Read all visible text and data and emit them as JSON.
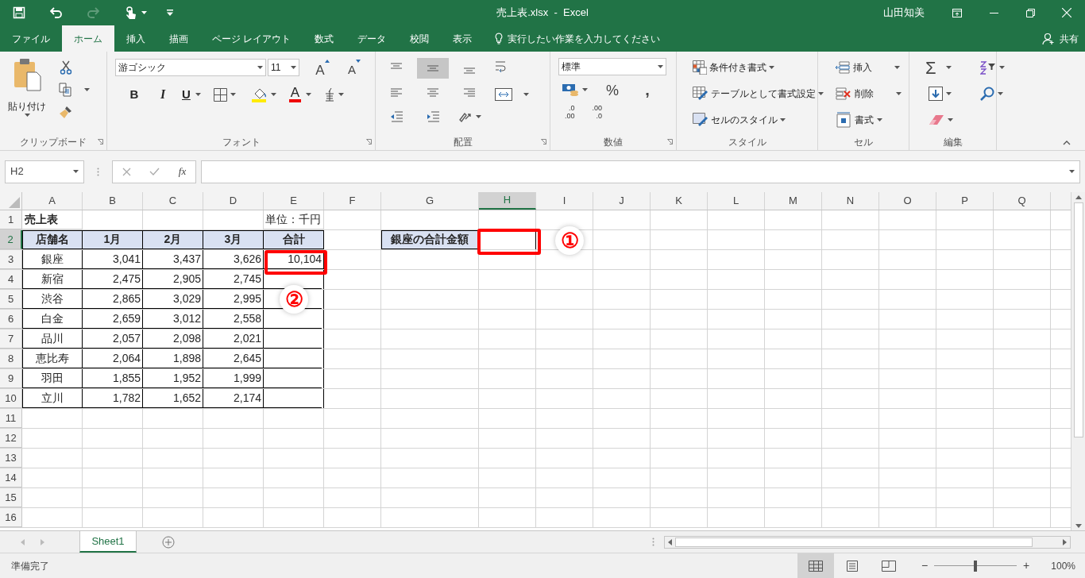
{
  "title_bar": {
    "title": "売上表.xlsx  -  Excel",
    "user": "山田知美"
  },
  "menu_tabs": [
    {
      "label": "ファイル",
      "selected": false
    },
    {
      "label": "ホーム",
      "selected": true
    },
    {
      "label": "挿入",
      "selected": false
    },
    {
      "label": "描画",
      "selected": false
    },
    {
      "label": "ページ レイアウト",
      "selected": false
    },
    {
      "label": "数式",
      "selected": false
    },
    {
      "label": "データ",
      "selected": false
    },
    {
      "label": "校閲",
      "selected": false
    },
    {
      "label": "表示",
      "selected": false
    }
  ],
  "tell_me": "実行したい作業を入力してください",
  "share": "共有",
  "ribbon": {
    "clipboard": {
      "paste": "貼り付け",
      "label": "クリップボード"
    },
    "font": {
      "font_name": "游ゴシック",
      "font_size": "11",
      "grow": "A",
      "shrink": "A",
      "bold": "B",
      "italic": "I",
      "underline": "U",
      "font_color": "A",
      "label": "フォント"
    },
    "alignment": {
      "vertical": [
        {
          "kind": "top",
          "selected": false
        },
        {
          "kind": "middle",
          "selected": true
        },
        {
          "kind": "bottom",
          "selected": false
        }
      ],
      "label": "配置"
    },
    "number": {
      "format": "標準",
      "percent": "%",
      "comma": ",",
      "decimals": [
        [
          ".0",
          ".00"
        ],
        [
          ".00",
          ".0"
        ]
      ],
      "label": "数値"
    },
    "styles": {
      "items": [
        "条件付き書式",
        "テーブルとして書式設定",
        "セルのスタイル"
      ],
      "label": "スタイル"
    },
    "cells": {
      "items": [
        "挿入",
        "削除",
        "書式"
      ],
      "label": "セル"
    },
    "editing": {
      "sum": "Σ",
      "label": "編集"
    }
  },
  "formula_bar": {
    "name_box": "H2",
    "fx": "fx"
  },
  "sheet": {
    "columns": [
      {
        "label": "A",
        "selected": false
      },
      {
        "label": "B",
        "selected": false
      },
      {
        "label": "C",
        "selected": false
      },
      {
        "label": "D",
        "selected": false
      },
      {
        "label": "E",
        "selected": false
      },
      {
        "label": "F",
        "selected": false
      },
      {
        "label": "G",
        "selected": false
      },
      {
        "label": "H",
        "selected": true
      },
      {
        "label": "I",
        "selected": false
      },
      {
        "label": "J",
        "selected": false
      },
      {
        "label": "K",
        "selected": false
      },
      {
        "label": "L",
        "selected": false
      },
      {
        "label": "M",
        "selected": false
      },
      {
        "label": "N",
        "selected": false
      },
      {
        "label": "O",
        "selected": false
      },
      {
        "label": "P",
        "selected": false
      },
      {
        "label": "Q",
        "selected": false
      }
    ],
    "rows": [
      {
        "label": "1",
        "selected": false
      },
      {
        "label": "2",
        "selected": true
      },
      {
        "label": "3",
        "selected": false
      },
      {
        "label": "4",
        "selected": false
      },
      {
        "label": "5",
        "selected": false
      },
      {
        "label": "6",
        "selected": false
      },
      {
        "label": "7",
        "selected": false
      },
      {
        "label": "8",
        "selected": false
      },
      {
        "label": "9",
        "selected": false
      },
      {
        "label": "10",
        "selected": false
      },
      {
        "label": "11",
        "selected": false
      },
      {
        "label": "12",
        "selected": false
      },
      {
        "label": "13",
        "selected": false
      },
      {
        "label": "14",
        "selected": false
      },
      {
        "label": "15",
        "selected": false
      },
      {
        "label": "16",
        "selected": false
      }
    ],
    "table": {
      "title": "売上表",
      "unit": "単位：千円",
      "headers": [
        "店舗名",
        "1月",
        "2月",
        "3月",
        "合計"
      ],
      "rows": [
        {
          "store": "銀座",
          "values": [
            "3,041",
            "3,437",
            "3,626"
          ],
          "total": "10,104"
        },
        {
          "store": "新宿",
          "values": [
            "2,475",
            "2,905",
            "2,745"
          ]
        },
        {
          "store": "渋谷",
          "values": [
            "2,865",
            "3,029",
            "2,995"
          ]
        },
        {
          "store": "白金",
          "values": [
            "2,659",
            "3,012",
            "2,558"
          ]
        },
        {
          "store": "品川",
          "values": [
            "2,057",
            "2,098",
            "2,021"
          ]
        },
        {
          "store": "恵比寿",
          "values": [
            "2,064",
            "1,898",
            "2,645"
          ]
        },
        {
          "store": "羽田",
          "values": [
            "1,855",
            "1,952",
            "1,999"
          ]
        },
        {
          "store": "立川",
          "values": [
            "1,782",
            "1,652",
            "2,174"
          ]
        }
      ]
    },
    "lookup": {
      "label": "銀座の合計金額"
    }
  },
  "callouts": [
    {
      "label": "①"
    },
    {
      "label": "②"
    }
  ],
  "sheet_tabs": [
    {
      "label": "Sheet1",
      "selected": true
    }
  ],
  "status_bar": {
    "status": "準備完了",
    "views": [
      {
        "kind": "normal",
        "selected": true
      },
      {
        "kind": "page_layout",
        "selected": false
      },
      {
        "kind": "page_break",
        "selected": false
      }
    ],
    "zoom": {
      "minus": "−",
      "plus": "+",
      "level": 0.5,
      "value": "100%"
    }
  }
}
